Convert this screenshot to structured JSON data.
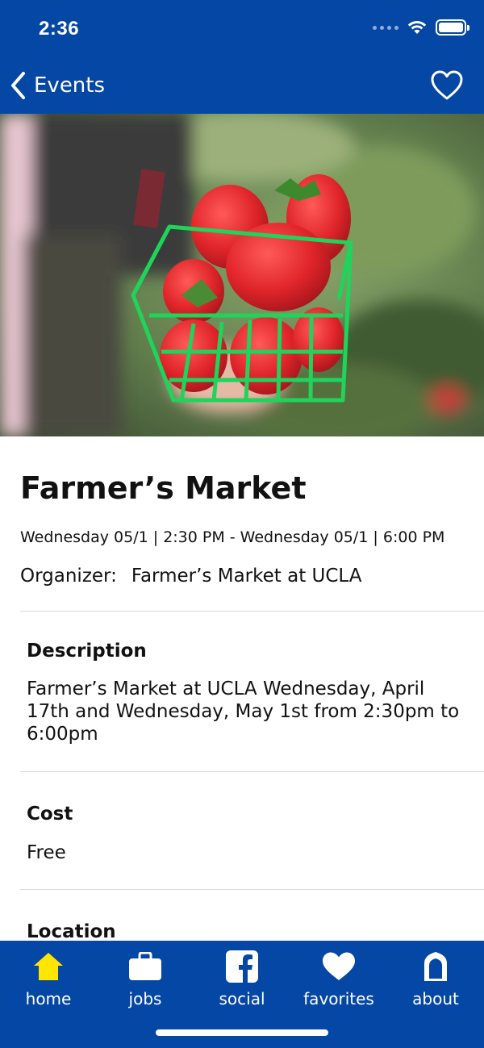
{
  "status_bar": {
    "time": "2:36"
  },
  "nav": {
    "back_label": "Events"
  },
  "event": {
    "title": "Farmer’s Market",
    "dates": "Wednesday 05/1 | 2:30 PM - Wednesday 05/1 | 6:00 PM",
    "organizer_label": "Organizer:",
    "organizer_value": "Farmer’s Market at UCLA"
  },
  "sections": {
    "description_heading": "Description",
    "description_body": "Farmer’s Market at UCLA Wednesday, April 17th and Wednesday, May 1st from 2:30pm to 6:00pm",
    "cost_heading": "Cost",
    "cost_body": "Free",
    "location_heading": "Location"
  },
  "tabbar": {
    "items": [
      {
        "label": "home",
        "icon": "home-icon",
        "active": true
      },
      {
        "label": "jobs",
        "icon": "briefcase-icon",
        "active": false
      },
      {
        "label": "social",
        "icon": "facebook-icon",
        "active": false
      },
      {
        "label": "favorites",
        "icon": "heart-icon",
        "active": false
      },
      {
        "label": "about",
        "icon": "arch-icon",
        "active": false
      }
    ]
  },
  "colors": {
    "brand_blue": "#0547a5",
    "active_tab": "#ffe600",
    "inactive_tab": "#ffffff",
    "divider": "#d8d8d8"
  }
}
